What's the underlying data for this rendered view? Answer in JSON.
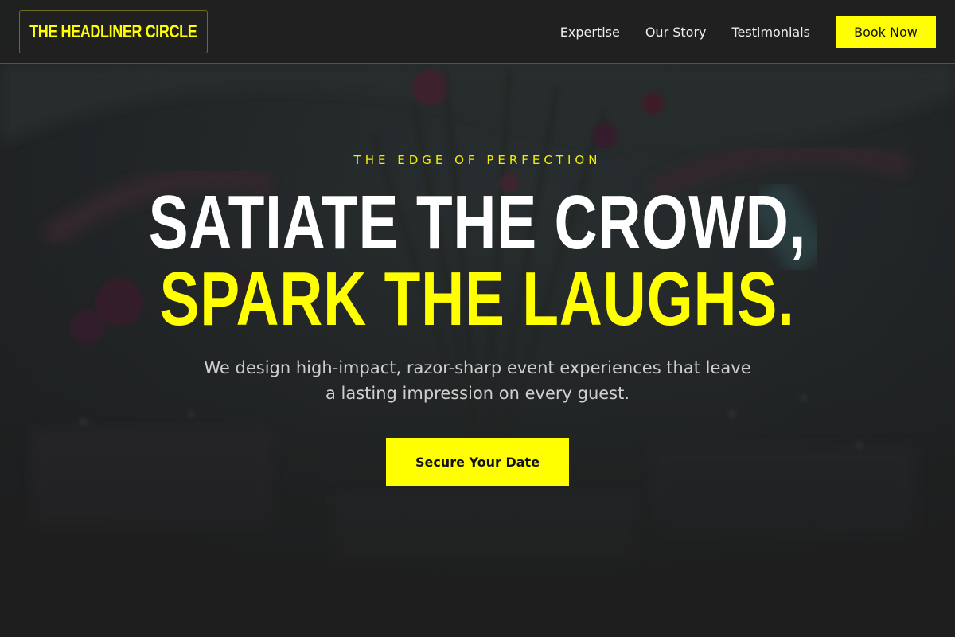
{
  "brand": {
    "name": "THE HEADLINER CIRCLE",
    "accent_color": "#ffff00"
  },
  "nav": {
    "items": [
      {
        "label": "Expertise"
      },
      {
        "label": "Our Story"
      },
      {
        "label": "Testimonials"
      }
    ],
    "cta_label": "Book Now"
  },
  "hero": {
    "eyebrow": "THE EDGE OF PERFECTION",
    "headline_line_1": "SATIATE THE CROWD,",
    "headline_line_2": "SPARK THE LAUGHS.",
    "subtext": "We design high-impact, razor-sharp event experiences that leave a lasting impression on every guest.",
    "cta_label": "Secure Your Date",
    "background_image": "dimmed event venue with floral centerpiece"
  }
}
